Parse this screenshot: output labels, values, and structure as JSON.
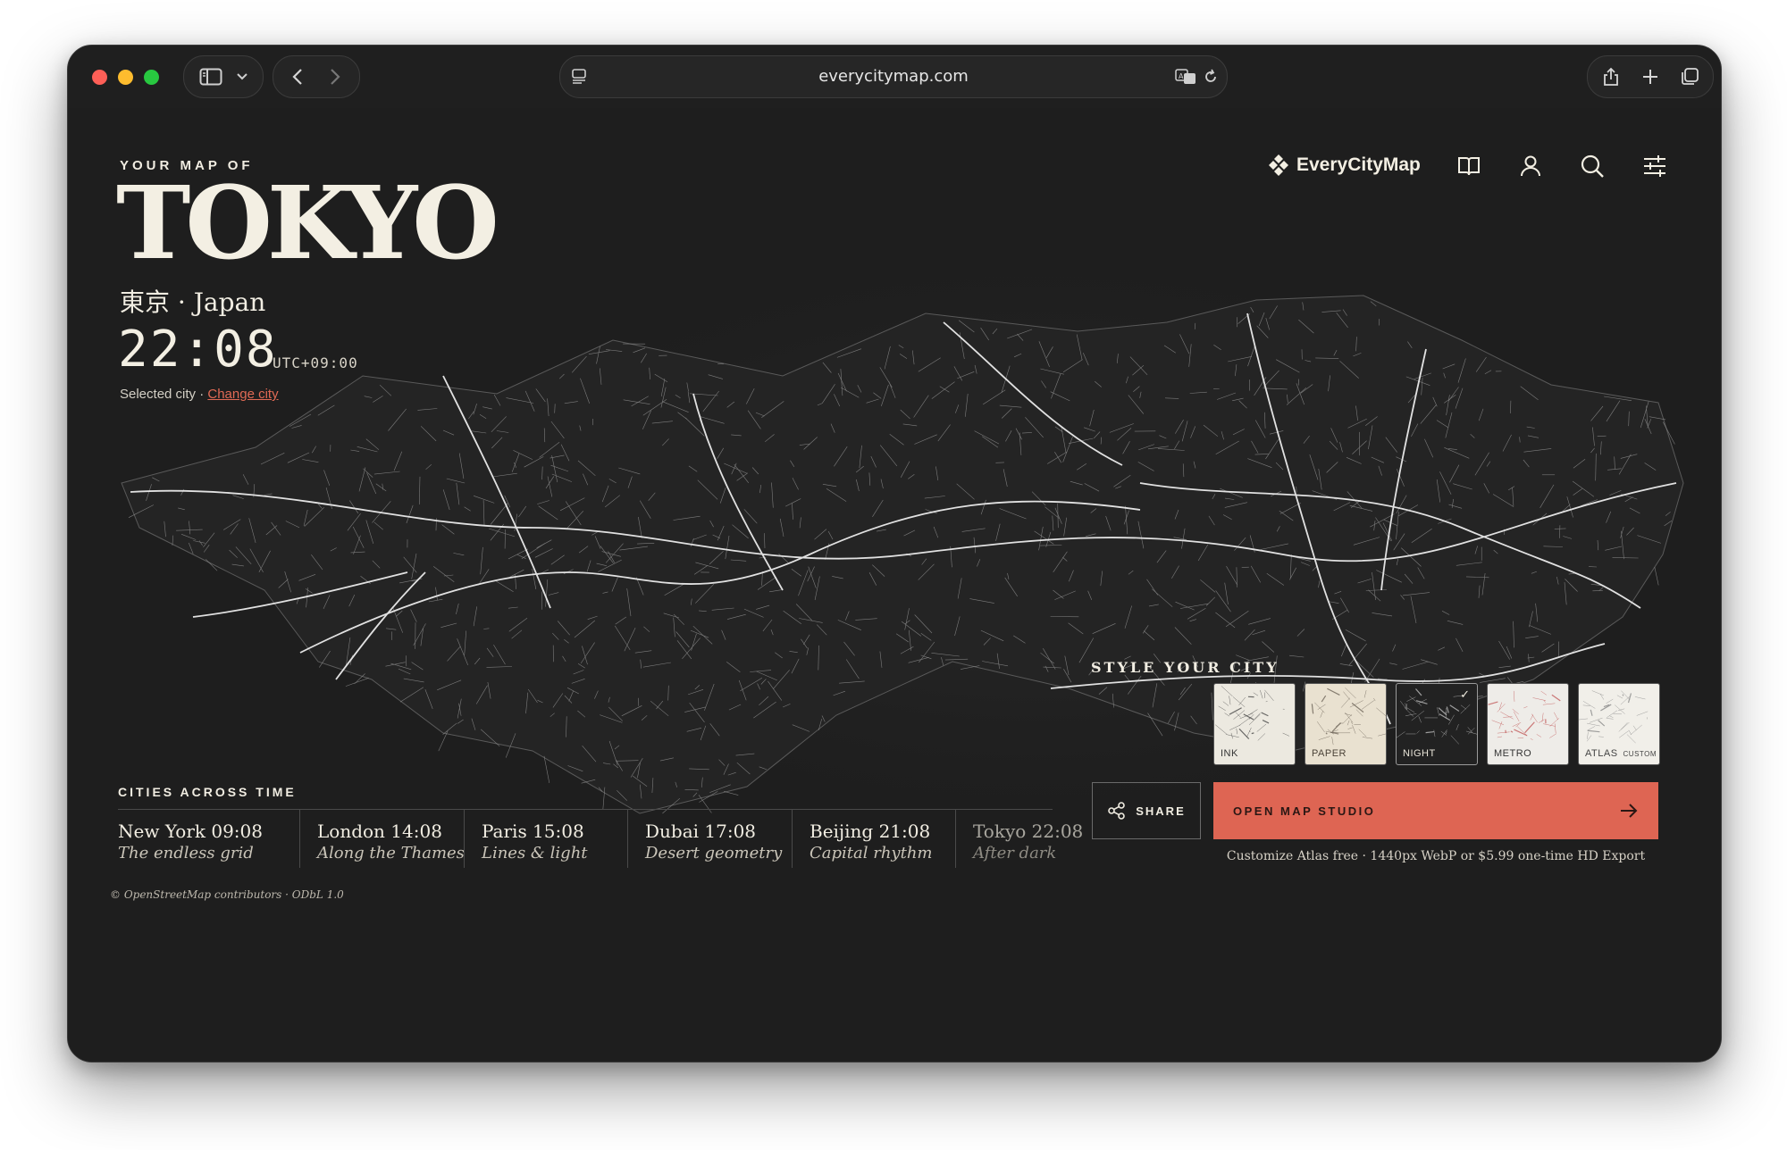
{
  "browser": {
    "url": "everycitymap.com"
  },
  "hero": {
    "eyebrow": "YOUR MAP OF",
    "city": "TOKYO",
    "subtitle": "東京 · Japan",
    "time": "22:08",
    "utc_offset": "UTC+09:00",
    "selected_text": "Selected city · ",
    "change_link": "Change city"
  },
  "nav": {
    "brand": "EveryCityMap",
    "icons": [
      "book-icon",
      "user-icon",
      "search-icon",
      "sliders-icon"
    ]
  },
  "styles": {
    "label": "STYLE YOUR CITY",
    "tiles": [
      {
        "name": "INK",
        "selected": false,
        "bg": "#ece9e0",
        "line": "#4a4a4a",
        "text": "#333333"
      },
      {
        "name": "PAPER",
        "selected": false,
        "bg": "#e9e1d0",
        "line": "#6d6458",
        "text": "#4b4338"
      },
      {
        "name": "NIGHT",
        "selected": true,
        "bg": "#222222",
        "line": "#bdbdbd",
        "text": "#e8e4d8"
      },
      {
        "name": "METRO",
        "selected": false,
        "bg": "#eeece8",
        "line": "#c25a5a",
        "text": "#333333"
      },
      {
        "name": "ATLAS",
        "custom": "CUSTOM",
        "selected": false,
        "bg": "#f1efe9",
        "line": "#8a8a8a",
        "text": "#444444"
      }
    ]
  },
  "actions": {
    "share": "SHARE",
    "studio": "OPEN MAP STUDIO",
    "note": "Customize Atlas free · 1440px WebP or $5.99 one-time HD Export"
  },
  "cities_across_time": {
    "label": "CITIES ACROSS TIME",
    "cities": [
      {
        "name": "New York 09:08",
        "tagline": "The endless grid"
      },
      {
        "name": "London 14:08",
        "tagline": "Along the Thames"
      },
      {
        "name": "Paris 15:08",
        "tagline": "Lines & light"
      },
      {
        "name": "Dubai 17:08",
        "tagline": "Desert geometry"
      },
      {
        "name": "Beijing 21:08",
        "tagline": "Capital rhythm"
      },
      {
        "name": "Tokyo 22:08",
        "tagline": "After dark"
      }
    ]
  },
  "attribution": "© OpenStreetMap contributors · ODbL 1.0",
  "colors": {
    "background": "#1e1e1e",
    "accent": "#de6553",
    "text": "#f3efe3"
  }
}
